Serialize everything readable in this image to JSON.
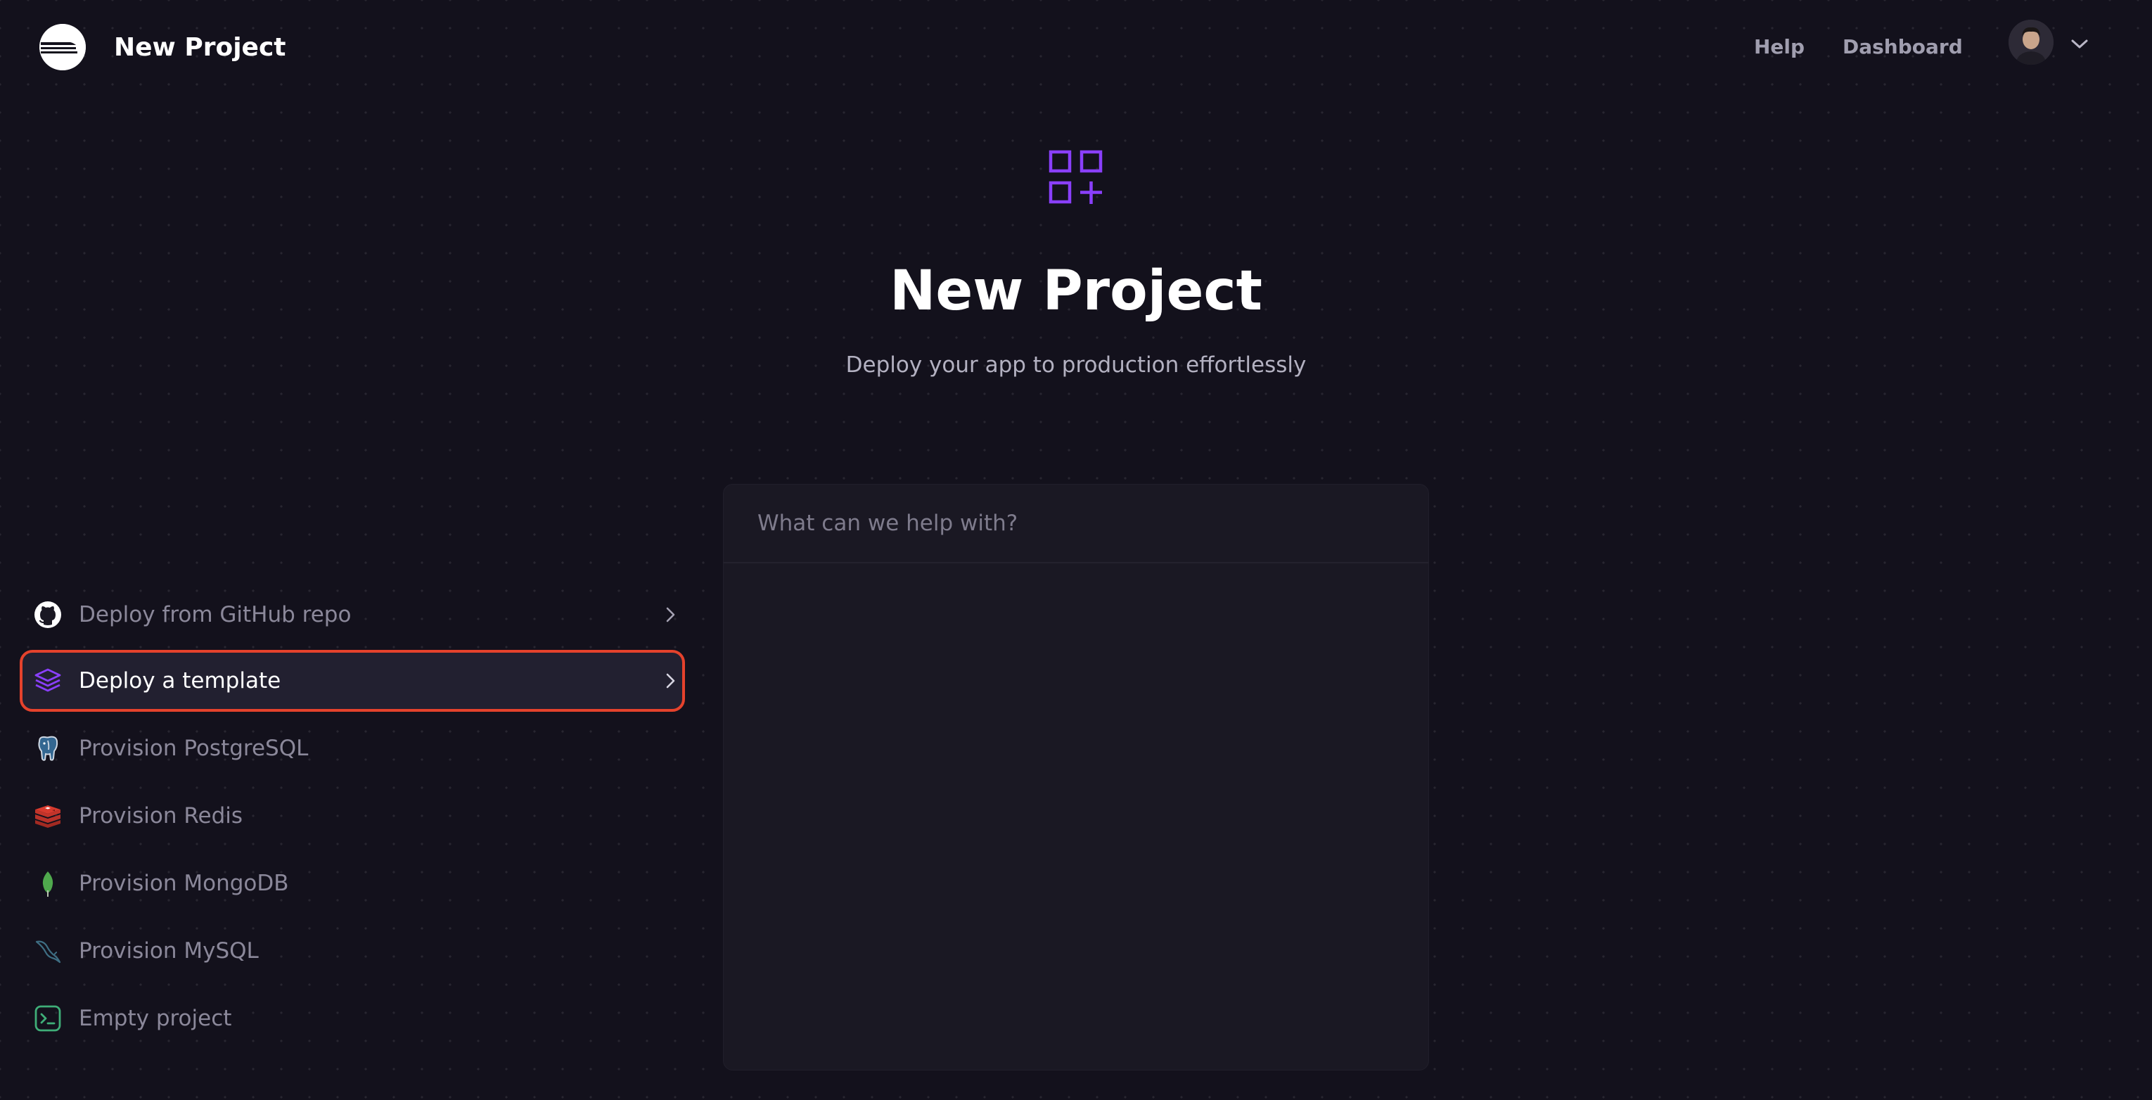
{
  "header": {
    "app_title": "New Project",
    "nav": {
      "help": "Help",
      "dashboard": "Dashboard"
    }
  },
  "hero": {
    "title": "New Project",
    "subtitle": "Deploy your app to production effortlessly",
    "icon": "grid-plus-icon"
  },
  "command": {
    "placeholder": "What can we help with?",
    "value": "",
    "options": [
      {
        "label": "Deploy from GitHub repo",
        "icon": "github-icon",
        "has_chevron": true,
        "selected": false
      },
      {
        "label": "Deploy a template",
        "icon": "layers-icon",
        "has_chevron": true,
        "selected": true
      },
      {
        "label": "Provision PostgreSQL",
        "icon": "postgresql-icon",
        "has_chevron": false,
        "selected": false
      },
      {
        "label": "Provision Redis",
        "icon": "redis-icon",
        "has_chevron": false,
        "selected": false
      },
      {
        "label": "Provision MongoDB",
        "icon": "mongodb-icon",
        "has_chevron": false,
        "selected": false
      },
      {
        "label": "Provision MySQL",
        "icon": "mysql-icon",
        "has_chevron": false,
        "selected": false
      },
      {
        "label": "Empty project",
        "icon": "terminal-icon",
        "has_chevron": false,
        "selected": false
      }
    ]
  },
  "colors": {
    "background": "#13111c",
    "panel": "#1a1823",
    "accent_purple": "#8a3ffc",
    "highlight_border": "#e5422c",
    "text_primary": "#ffffff",
    "text_muted": "#8b889a"
  }
}
